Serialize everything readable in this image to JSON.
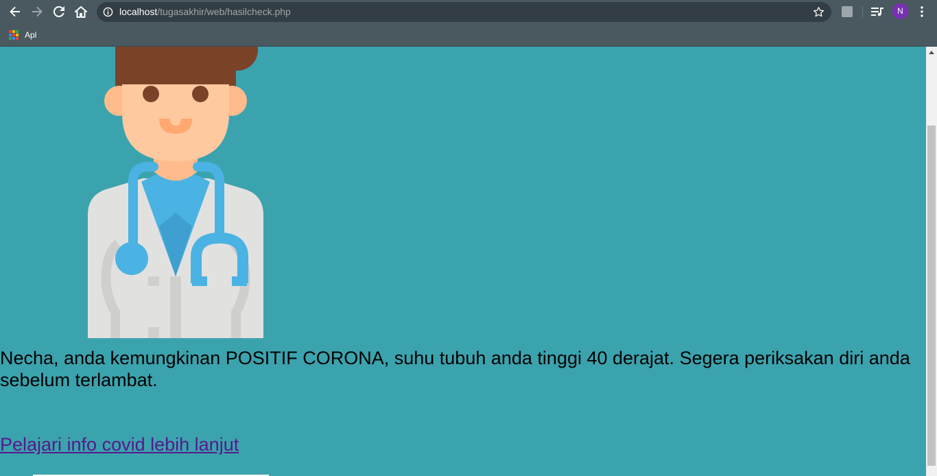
{
  "browser": {
    "url_host": "localhost",
    "url_path": "/tugasakhir/web/hasilcheck.php",
    "profile_initial": "N",
    "bookmarks": [
      {
        "label": "Apl"
      }
    ]
  },
  "page": {
    "result_message": "Necha, anda kemungkinan POSITIF CORONA, suhu tubuh anda tinggi 40 derajat. Segera periksakan diri anda sebelum terlambat.",
    "info_link": "Pelajari info covid lebih lanjut"
  },
  "colors": {
    "page_background": "#3ba3ae",
    "link": "#551a8b",
    "chrome_toolbar": "#4a5960",
    "avatar": "#7a2fb5"
  },
  "icons": {
    "back": "back-arrow-icon",
    "forward": "forward-arrow-icon",
    "reload": "reload-icon",
    "home": "home-icon",
    "site_info": "info-icon",
    "bookmark_star": "star-icon",
    "extension": "extension-icon",
    "media": "media-queue-icon",
    "menu": "kebab-menu-icon",
    "apps": "apps-grid-icon",
    "illustration": "doctor-illustration"
  }
}
